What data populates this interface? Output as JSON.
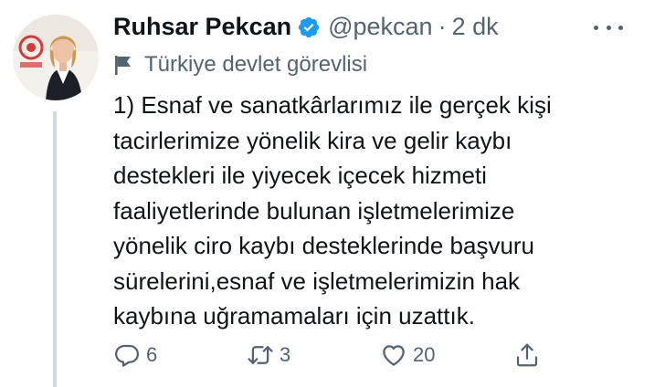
{
  "author": {
    "name": "Ruhsar Pekcan",
    "handle": "@pekcan",
    "separator": "·",
    "time": "2 dk",
    "label": "Türkiye devlet görevlisi"
  },
  "tweet": {
    "lines": [
      "1) Esnaf ve sanatkârlarımız ile gerçek kişi",
      "tacirlerimize yönelik kira ve gelir kaybı",
      "destekleri ile yiyecek içecek hizmeti",
      "faaliyetlerinde bulunan işletmelerimize",
      "yönelik ciro kaybı desteklerinde başvuru",
      "sürelerini,esnaf ve işletmelerimizin hak",
      "kaybına uğramamaları için uzattık."
    ]
  },
  "actions": {
    "reply_count": "6",
    "retweet_count": "3",
    "like_count": "20"
  },
  "colors": {
    "text": "#0f1419",
    "secondary": "#536471",
    "verified": "#1d9bf0",
    "thread_line": "#cfd9de"
  },
  "icons": [
    "verified-badge-icon",
    "more-icon",
    "flag-icon",
    "reply-icon",
    "retweet-icon",
    "like-icon",
    "share-icon"
  ]
}
